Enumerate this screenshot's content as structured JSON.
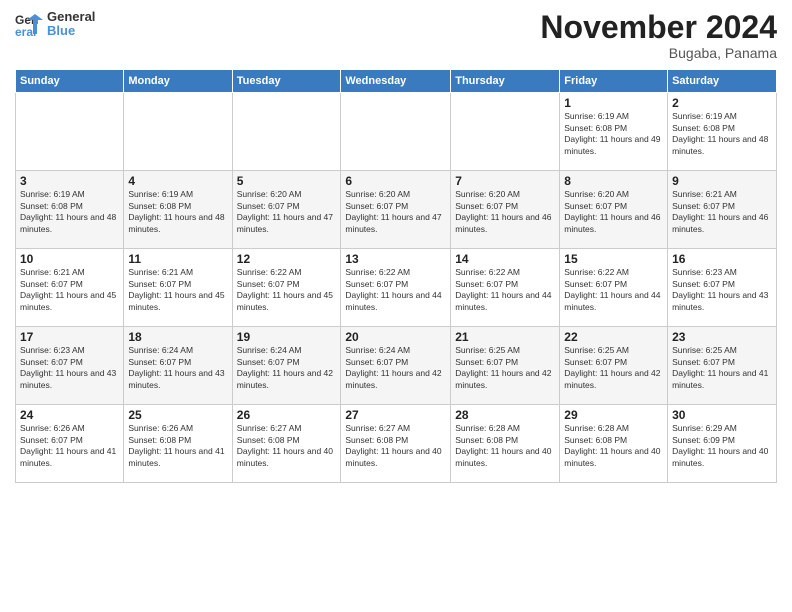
{
  "logo": {
    "line1": "General",
    "line2": "Blue"
  },
  "header": {
    "title": "November 2024",
    "subtitle": "Bugaba, Panama"
  },
  "days_of_week": [
    "Sunday",
    "Monday",
    "Tuesday",
    "Wednesday",
    "Thursday",
    "Friday",
    "Saturday"
  ],
  "weeks": [
    [
      {
        "day": "",
        "info": ""
      },
      {
        "day": "",
        "info": ""
      },
      {
        "day": "",
        "info": ""
      },
      {
        "day": "",
        "info": ""
      },
      {
        "day": "",
        "info": ""
      },
      {
        "day": "1",
        "info": "Sunrise: 6:19 AM\nSunset: 6:08 PM\nDaylight: 11 hours and 49 minutes."
      },
      {
        "day": "2",
        "info": "Sunrise: 6:19 AM\nSunset: 6:08 PM\nDaylight: 11 hours and 48 minutes."
      }
    ],
    [
      {
        "day": "3",
        "info": "Sunrise: 6:19 AM\nSunset: 6:08 PM\nDaylight: 11 hours and 48 minutes."
      },
      {
        "day": "4",
        "info": "Sunrise: 6:19 AM\nSunset: 6:08 PM\nDaylight: 11 hours and 48 minutes."
      },
      {
        "day": "5",
        "info": "Sunrise: 6:20 AM\nSunset: 6:07 PM\nDaylight: 11 hours and 47 minutes."
      },
      {
        "day": "6",
        "info": "Sunrise: 6:20 AM\nSunset: 6:07 PM\nDaylight: 11 hours and 47 minutes."
      },
      {
        "day": "7",
        "info": "Sunrise: 6:20 AM\nSunset: 6:07 PM\nDaylight: 11 hours and 46 minutes."
      },
      {
        "day": "8",
        "info": "Sunrise: 6:20 AM\nSunset: 6:07 PM\nDaylight: 11 hours and 46 minutes."
      },
      {
        "day": "9",
        "info": "Sunrise: 6:21 AM\nSunset: 6:07 PM\nDaylight: 11 hours and 46 minutes."
      }
    ],
    [
      {
        "day": "10",
        "info": "Sunrise: 6:21 AM\nSunset: 6:07 PM\nDaylight: 11 hours and 45 minutes."
      },
      {
        "day": "11",
        "info": "Sunrise: 6:21 AM\nSunset: 6:07 PM\nDaylight: 11 hours and 45 minutes."
      },
      {
        "day": "12",
        "info": "Sunrise: 6:22 AM\nSunset: 6:07 PM\nDaylight: 11 hours and 45 minutes."
      },
      {
        "day": "13",
        "info": "Sunrise: 6:22 AM\nSunset: 6:07 PM\nDaylight: 11 hours and 44 minutes."
      },
      {
        "day": "14",
        "info": "Sunrise: 6:22 AM\nSunset: 6:07 PM\nDaylight: 11 hours and 44 minutes."
      },
      {
        "day": "15",
        "info": "Sunrise: 6:22 AM\nSunset: 6:07 PM\nDaylight: 11 hours and 44 minutes."
      },
      {
        "day": "16",
        "info": "Sunrise: 6:23 AM\nSunset: 6:07 PM\nDaylight: 11 hours and 43 minutes."
      }
    ],
    [
      {
        "day": "17",
        "info": "Sunrise: 6:23 AM\nSunset: 6:07 PM\nDaylight: 11 hours and 43 minutes."
      },
      {
        "day": "18",
        "info": "Sunrise: 6:24 AM\nSunset: 6:07 PM\nDaylight: 11 hours and 43 minutes."
      },
      {
        "day": "19",
        "info": "Sunrise: 6:24 AM\nSunset: 6:07 PM\nDaylight: 11 hours and 42 minutes."
      },
      {
        "day": "20",
        "info": "Sunrise: 6:24 AM\nSunset: 6:07 PM\nDaylight: 11 hours and 42 minutes."
      },
      {
        "day": "21",
        "info": "Sunrise: 6:25 AM\nSunset: 6:07 PM\nDaylight: 11 hours and 42 minutes."
      },
      {
        "day": "22",
        "info": "Sunrise: 6:25 AM\nSunset: 6:07 PM\nDaylight: 11 hours and 42 minutes."
      },
      {
        "day": "23",
        "info": "Sunrise: 6:25 AM\nSunset: 6:07 PM\nDaylight: 11 hours and 41 minutes."
      }
    ],
    [
      {
        "day": "24",
        "info": "Sunrise: 6:26 AM\nSunset: 6:07 PM\nDaylight: 11 hours and 41 minutes."
      },
      {
        "day": "25",
        "info": "Sunrise: 6:26 AM\nSunset: 6:08 PM\nDaylight: 11 hours and 41 minutes."
      },
      {
        "day": "26",
        "info": "Sunrise: 6:27 AM\nSunset: 6:08 PM\nDaylight: 11 hours and 40 minutes."
      },
      {
        "day": "27",
        "info": "Sunrise: 6:27 AM\nSunset: 6:08 PM\nDaylight: 11 hours and 40 minutes."
      },
      {
        "day": "28",
        "info": "Sunrise: 6:28 AM\nSunset: 6:08 PM\nDaylight: 11 hours and 40 minutes."
      },
      {
        "day": "29",
        "info": "Sunrise: 6:28 AM\nSunset: 6:08 PM\nDaylight: 11 hours and 40 minutes."
      },
      {
        "day": "30",
        "info": "Sunrise: 6:29 AM\nSunset: 6:09 PM\nDaylight: 11 hours and 40 minutes."
      }
    ]
  ]
}
